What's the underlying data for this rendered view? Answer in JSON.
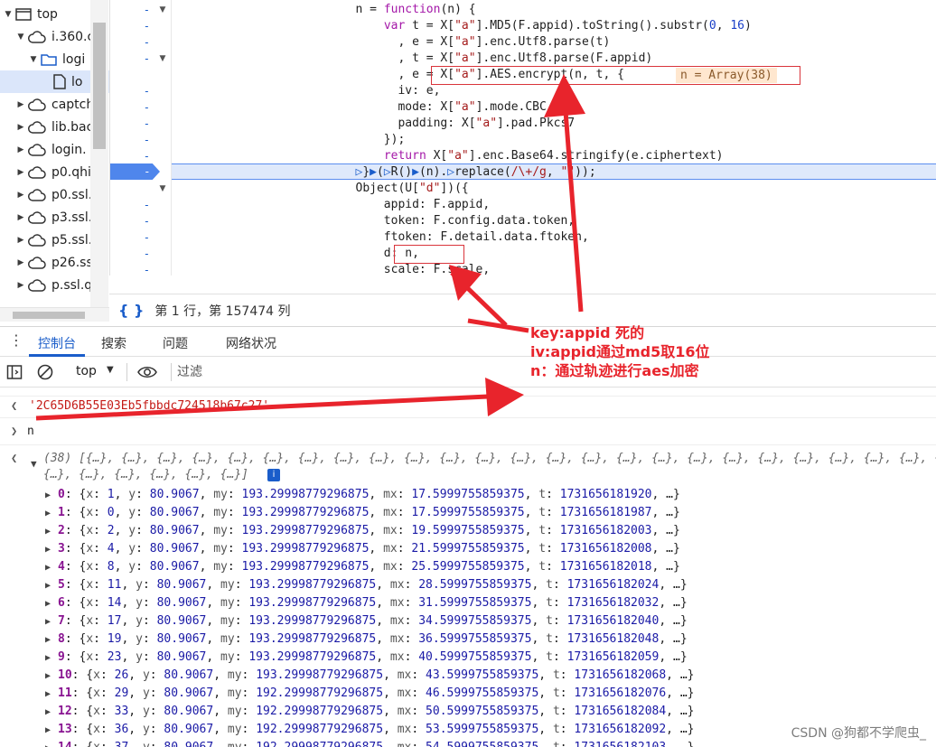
{
  "tree": {
    "items": [
      {
        "label": "top",
        "icon": "window-icon",
        "expanded": true
      },
      {
        "label": "i.360.c",
        "icon": "cloud-icon",
        "expanded": true
      },
      {
        "label": "logi",
        "icon": "folder-icon",
        "expanded": true
      },
      {
        "label": "lo",
        "icon": "file-icon",
        "expanded": false
      },
      {
        "label": "captch",
        "icon": "cloud-icon",
        "expanded": false
      },
      {
        "label": "lib.bac",
        "icon": "cloud-icon",
        "expanded": false
      },
      {
        "label": "login.",
        "icon": "cloud-icon",
        "expanded": false
      },
      {
        "label": "p0.qhi",
        "icon": "cloud-icon",
        "expanded": false
      },
      {
        "label": "p0.ssl.",
        "icon": "cloud-icon",
        "expanded": false
      },
      {
        "label": "p3.ssl.",
        "icon": "cloud-icon",
        "expanded": false
      },
      {
        "label": "p5.ssl.",
        "icon": "cloud-icon",
        "expanded": false
      },
      {
        "label": "p26.ss",
        "icon": "cloud-icon",
        "expanded": false
      },
      {
        "label": "p.ssl.q",
        "icon": "cloud-icon",
        "expanded": false
      }
    ]
  },
  "editor": {
    "current_line_marker": "-",
    "inline_value": "n = Array(38)"
  },
  "status": {
    "text": "第 1 行，第 157474 列"
  },
  "drawer": {
    "tabs": [
      "控制台",
      "搜索",
      "问题",
      "网络状况"
    ],
    "active_tab": "控制台"
  },
  "console_toolbar": {
    "context": "top",
    "filter_placeholder": "过滤"
  },
  "console": {
    "result_string": "'2C65D6B55E03Eb5fbbdc724518b67c27'",
    "input_expr": "n",
    "array_summary_line1": "(38) [{…}, {…}, {…}, {…}, {…}, {…}, {…}, {…}, {…}, {…}, {…}, {…}, {…}, {…}, {…}, {…}, {…}, {…}, {…}, {…}, {…}, {…}, {…}, {…}, {…}, {…}, {…}, {…}, {…}, {…}, {…}, {…}",
    "array_summary_line2": "{…}, {…}, {…}, {…}, {…}, {…}]",
    "rows": [
      {
        "i": "0",
        "x": "1",
        "y": "80.9067",
        "my": "193.29998779296875",
        "mx": "17.5999755859375",
        "t": "1731656181920"
      },
      {
        "i": "1",
        "x": "0",
        "y": "80.9067",
        "my": "193.29998779296875",
        "mx": "17.5999755859375",
        "t": "1731656181987"
      },
      {
        "i": "2",
        "x": "2",
        "y": "80.9067",
        "my": "193.29998779296875",
        "mx": "19.5999755859375",
        "t": "1731656182003"
      },
      {
        "i": "3",
        "x": "4",
        "y": "80.9067",
        "my": "193.29998779296875",
        "mx": "21.5999755859375",
        "t": "1731656182008"
      },
      {
        "i": "4",
        "x": "8",
        "y": "80.9067",
        "my": "193.29998779296875",
        "mx": "25.5999755859375",
        "t": "1731656182018"
      },
      {
        "i": "5",
        "x": "11",
        "y": "80.9067",
        "my": "193.29998779296875",
        "mx": "28.5999755859375",
        "t": "1731656182024"
      },
      {
        "i": "6",
        "x": "14",
        "y": "80.9067",
        "my": "193.29998779296875",
        "mx": "31.5999755859375",
        "t": "1731656182032"
      },
      {
        "i": "7",
        "x": "17",
        "y": "80.9067",
        "my": "193.29998779296875",
        "mx": "34.5999755859375",
        "t": "1731656182040"
      },
      {
        "i": "8",
        "x": "19",
        "y": "80.9067",
        "my": "193.29998779296875",
        "mx": "36.5999755859375",
        "t": "1731656182048"
      },
      {
        "i": "9",
        "x": "23",
        "y": "80.9067",
        "my": "193.29998779296875",
        "mx": "40.5999755859375",
        "t": "1731656182059"
      },
      {
        "i": "10",
        "x": "26",
        "y": "80.9067",
        "my": "193.29998779296875",
        "mx": "43.5999755859375",
        "t": "1731656182068"
      },
      {
        "i": "11",
        "x": "29",
        "y": "80.9067",
        "my": "192.29998779296875",
        "mx": "46.5999755859375",
        "t": "1731656182076"
      },
      {
        "i": "12",
        "x": "33",
        "y": "80.9067",
        "my": "192.29998779296875",
        "mx": "50.5999755859375",
        "t": "1731656182084"
      },
      {
        "i": "13",
        "x": "36",
        "y": "80.9067",
        "my": "192.29998779296875",
        "mx": "53.5999755859375",
        "t": "1731656182092"
      },
      {
        "i": "14",
        "x": "37",
        "y": "80.9067",
        "my": "192.29998779296875",
        "mx": "54.5999755859375",
        "t": "1731656182103"
      }
    ]
  },
  "annotation": {
    "line1": "key:appid 死的",
    "line2": "iv:appid通过md5取16位",
    "line3": "n：通过轨迹进行aes加密"
  },
  "watermark": "CSDN @狗都不学爬虫_",
  "colors": {
    "annotation_red": "#e8242c",
    "accent_blue": "#1a5dca",
    "current_line_bg": "#dfe9fb"
  }
}
